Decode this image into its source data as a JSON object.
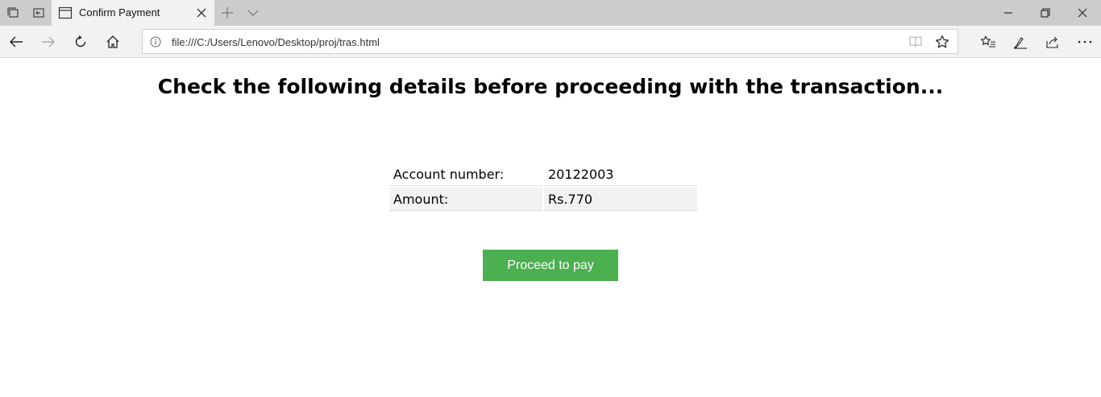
{
  "browser": {
    "tab": {
      "title": "Confirm Payment"
    },
    "address": {
      "url": "file:///C:/Users/Lenovo/Desktop/proj/tras.html"
    },
    "icons": {
      "tab_strip": [
        "tabs-aside-icon",
        "restore-tabs-icon",
        "new-tab-icon",
        "tab-preview-icon"
      ],
      "window": [
        "minimize-icon",
        "restore-icon",
        "close-icon"
      ],
      "nav": [
        "back-icon",
        "forward-icon",
        "refresh-icon",
        "home-icon"
      ],
      "address": [
        "info-icon",
        "reading-view-icon",
        "favorite-star-icon"
      ],
      "toolbar": [
        "favorites-icon",
        "web-note-icon",
        "share-icon",
        "more-icon"
      ]
    }
  },
  "page": {
    "heading": "Check the following details before proceeding with the transaction...",
    "details": [
      {
        "label": "Account number:",
        "value": "20122003"
      },
      {
        "label": "Amount:",
        "value": "Rs.770"
      }
    ],
    "proceed_label": "Proceed to pay",
    "colors": {
      "button_bg": "#4caf50",
      "button_text": "#ffffff",
      "alt_row_bg": "#f2f2f2"
    }
  }
}
